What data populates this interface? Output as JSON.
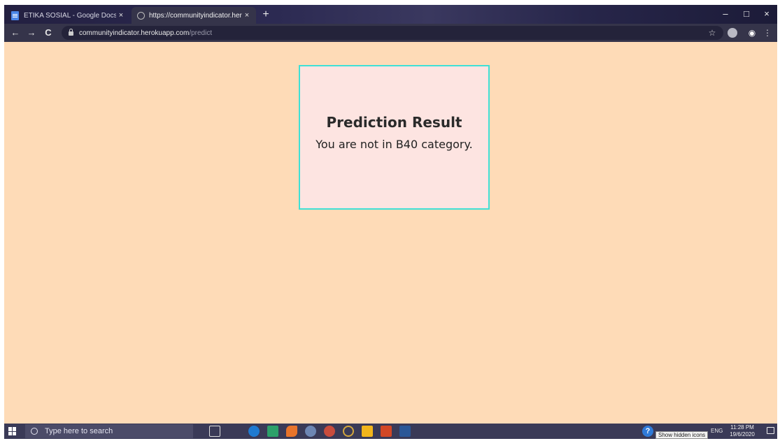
{
  "browser": {
    "tabs": [
      {
        "title": "ETIKA SOSIAL - Google Docs",
        "active": false,
        "icon": "docs-icon"
      },
      {
        "title": "https://communityindicator.herokuapp.com/predict",
        "active": true,
        "icon": "globe-icon"
      }
    ],
    "new_tab_label": "+",
    "close_glyph": "×",
    "window_controls": {
      "minimize": "–",
      "maximize": "□",
      "close": "×"
    },
    "nav": {
      "back": "←",
      "forward": "→",
      "reload": "C"
    },
    "address": {
      "host": "communityindicator.herokuapp.com",
      "path": "/predict"
    },
    "star": "☆",
    "menu": "⋮"
  },
  "page": {
    "background_color": "#fedbb7",
    "card": {
      "heading": "Prediction Result",
      "message": "You are not in B40 category.",
      "background_color": "#fde4e1",
      "border_color": "#3fe0d6"
    }
  },
  "taskbar": {
    "search_placeholder": "Type here to search",
    "apps": [
      "task-view-icon",
      "edge-icon",
      "pycharm-icon",
      "matlab-icon",
      "app-icon",
      "chrome-icon",
      "anaconda-icon",
      "sticky-notes-icon",
      "powerpoint-icon",
      "word-icon"
    ],
    "tray_help": "?",
    "tooltip": "Show hidden icons",
    "language": "ENG",
    "time": "11:28 PM",
    "date": "19/6/2020"
  }
}
